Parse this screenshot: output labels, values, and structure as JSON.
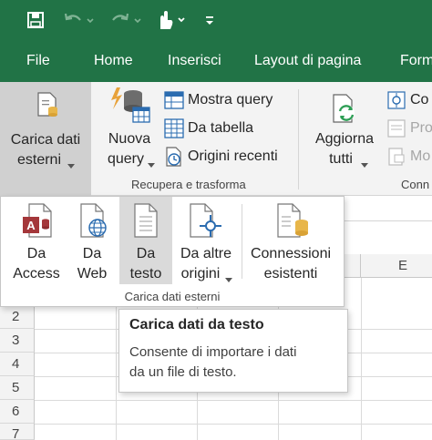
{
  "qat": {
    "save_icon": "save-icon",
    "undo_icon": "undo-icon",
    "redo_icon": "redo-icon",
    "touch_icon": "touch-mode-icon",
    "customize_icon": "customize-qat-icon"
  },
  "tabs": [
    "File",
    "Home",
    "Inserisci",
    "Layout di pagina",
    "Form"
  ],
  "ribbon": {
    "carica_dati_esterni": {
      "line1": "Carica dati",
      "line2": "esterni"
    },
    "nuova_query": {
      "line1": "Nuova",
      "line2": "query"
    },
    "mostra_query": "Mostra query",
    "da_tabella": "Da tabella",
    "origini_recenti": "Origini recenti",
    "group_recupera": "Recupera e trasforma",
    "aggiorna_tutti": {
      "line1": "Aggiorna",
      "line2": "tutti"
    },
    "conn_items": [
      "Co",
      "Pro",
      "Mo"
    ],
    "group_conn": "Conn"
  },
  "dropdown": {
    "items": [
      {
        "line1": "Da",
        "line2": "Access"
      },
      {
        "line1": "Da",
        "line2": "Web"
      },
      {
        "line1": "Da",
        "line2": "testo"
      },
      {
        "line1": "Da altre",
        "line2": "origini"
      },
      {
        "line1": "Connessioni",
        "line2": "esistenti"
      }
    ],
    "group_label": "Carica dati esterni"
  },
  "sheet": {
    "column_header_visible": "E",
    "row_numbers": [
      "2",
      "3",
      "4",
      "5",
      "6",
      "7"
    ]
  },
  "tooltip": {
    "title": "Carica dati da testo",
    "description_line1": "Consente di importare i dati",
    "description_line2": "da un file di testo."
  },
  "colors": {
    "excel_green": "#217346",
    "ribbon_bg": "#f3f3f3",
    "selected_bg": "#d0d0d0",
    "hover_bg": "#dadada"
  }
}
